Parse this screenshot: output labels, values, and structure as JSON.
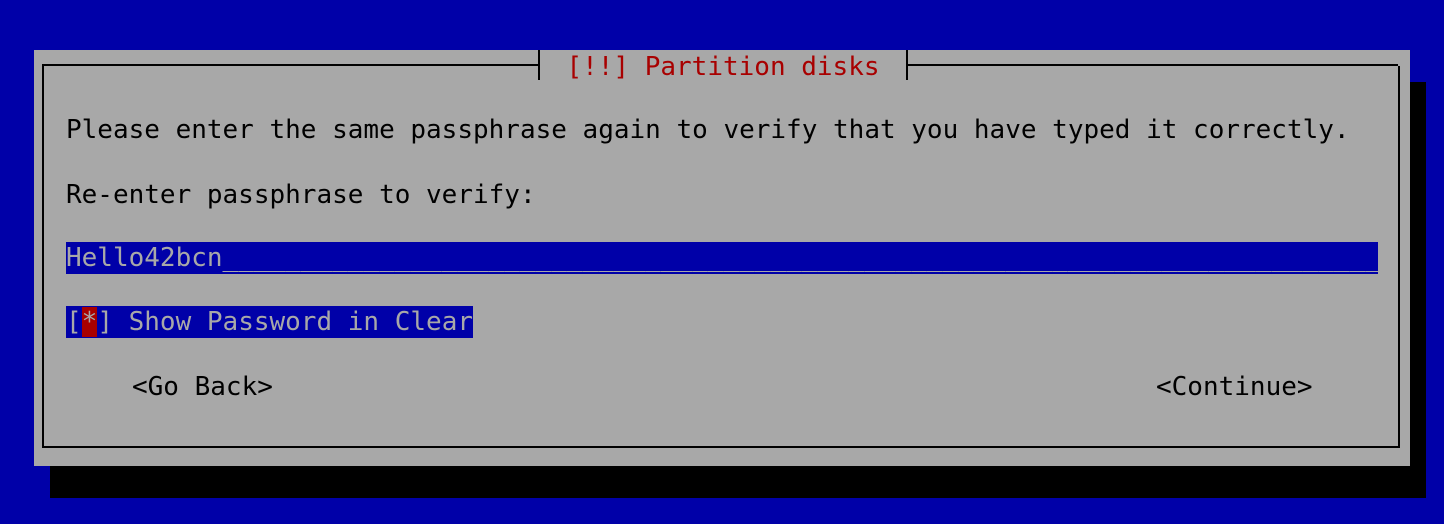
{
  "dialog": {
    "title": "[!!] Partition disks",
    "prompt": "Please enter the same passphrase again to verify that you have typed it correctly.",
    "field_label": "Re-enter passphrase to verify:",
    "input_value": "Hello42bcn",
    "input_fill": "_______________________________________________________________________________",
    "checkbox": {
      "open_bracket": "[",
      "mark": "*",
      "close_bracket": "]",
      "label": " Show Password in Clear"
    },
    "buttons": {
      "back_label": "<Go Back>",
      "continue_label": "<Continue>"
    }
  },
  "colors": {
    "background": "#0000a8",
    "dialog": "#a8a8a8",
    "title": "#a80000",
    "highlight": "#0000a8",
    "checkbox_cursor": "#a80000"
  }
}
